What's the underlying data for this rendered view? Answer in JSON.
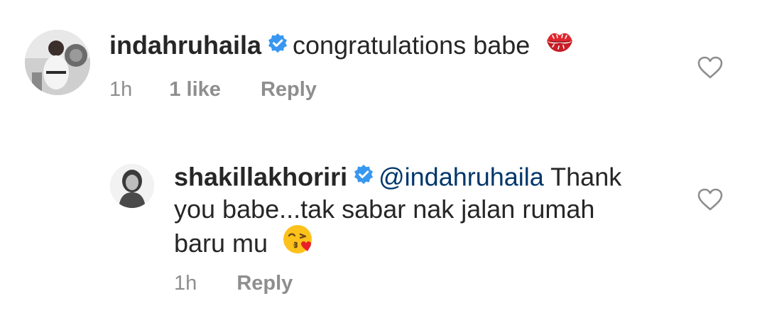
{
  "comments": [
    {
      "username": "indahruhaila",
      "text": "congratulations babe",
      "time": "1h",
      "likes": "1 like",
      "reply_label": "Reply",
      "emoji": "kiss-mark-icon"
    },
    {
      "username": "shakillakhoriri",
      "mention": "@indahruhaila",
      "text_line1": "Thank",
      "text_line2": "you babe...tak sabar nak jalan rumah",
      "text_line3": "baru mu",
      "time": "1h",
      "reply_label": "Reply",
      "emoji": "face-blowing-kiss-icon"
    }
  ],
  "colors": {
    "verified": "#3897f0",
    "mention": "#00376b",
    "meta": "#8e8e8e",
    "text": "#262626"
  }
}
